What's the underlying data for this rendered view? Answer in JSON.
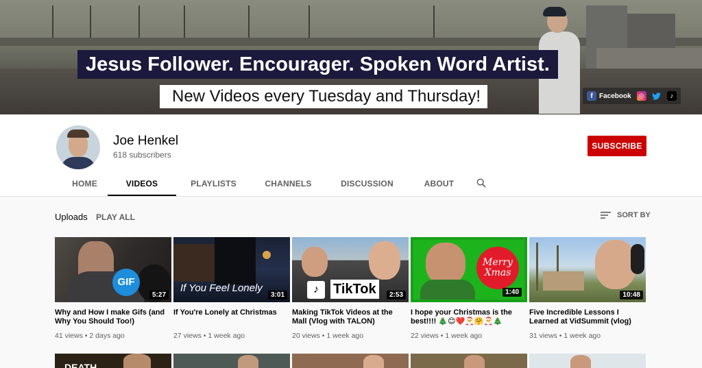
{
  "banner": {
    "headline": "Jesus Follower. Encourager. Spoken Word Artist.",
    "tagline": "New Videos every Tuesday and Thursday!",
    "social": {
      "facebook_label": "Facebook",
      "icons": [
        "facebook-icon",
        "instagram-icon",
        "twitter-icon",
        "tiktok-icon"
      ]
    }
  },
  "channel": {
    "name": "Joe Henkel",
    "subscribers": "618 subscribers",
    "subscribe_label": "SUBSCRIBE",
    "subscribe_color": "#cc0000"
  },
  "tabs": [
    {
      "label": "HOME",
      "active": false
    },
    {
      "label": "VIDEOS",
      "active": true
    },
    {
      "label": "PLAYLISTS",
      "active": false
    },
    {
      "label": "CHANNELS",
      "active": false
    },
    {
      "label": "DISCUSSION",
      "active": false
    },
    {
      "label": "ABOUT",
      "active": false
    }
  ],
  "section": {
    "title": "Uploads",
    "play_all": "PLAY ALL",
    "sort_by": "SORT BY"
  },
  "videos": [
    {
      "title": "Why and How I make Gifs (and Why You Should Too!)",
      "duration": "5:27",
      "views": "41 views",
      "age": "2 days ago",
      "thumb_text": "GIF"
    },
    {
      "title": "If You're Lonely at Christmas",
      "duration": "3:01",
      "views": "27 views",
      "age": "1 week ago",
      "thumb_text": "If You Feel Lonely"
    },
    {
      "title": "Making TikTok Videos at the Mall (Vlog with TALON)",
      "duration": "2:53",
      "views": "20 views",
      "age": "1 week ago",
      "thumb_text": "TikTok"
    },
    {
      "title": "I hope your Christmas is the best!!!! 🎄😊❤️🎅🤗🎅🎄",
      "duration": "1:40",
      "views": "22 views",
      "age": "1 week ago",
      "thumb_text": "Merry Xmas"
    },
    {
      "title": "Five Incredible Lessons I Learned at VidSummit (vlog)",
      "duration": "10:48",
      "views": "31 views",
      "age": "1 week ago",
      "thumb_text": ""
    }
  ],
  "second_row": {
    "first_thumb_text": "DEATH"
  },
  "meta_separator": "•"
}
